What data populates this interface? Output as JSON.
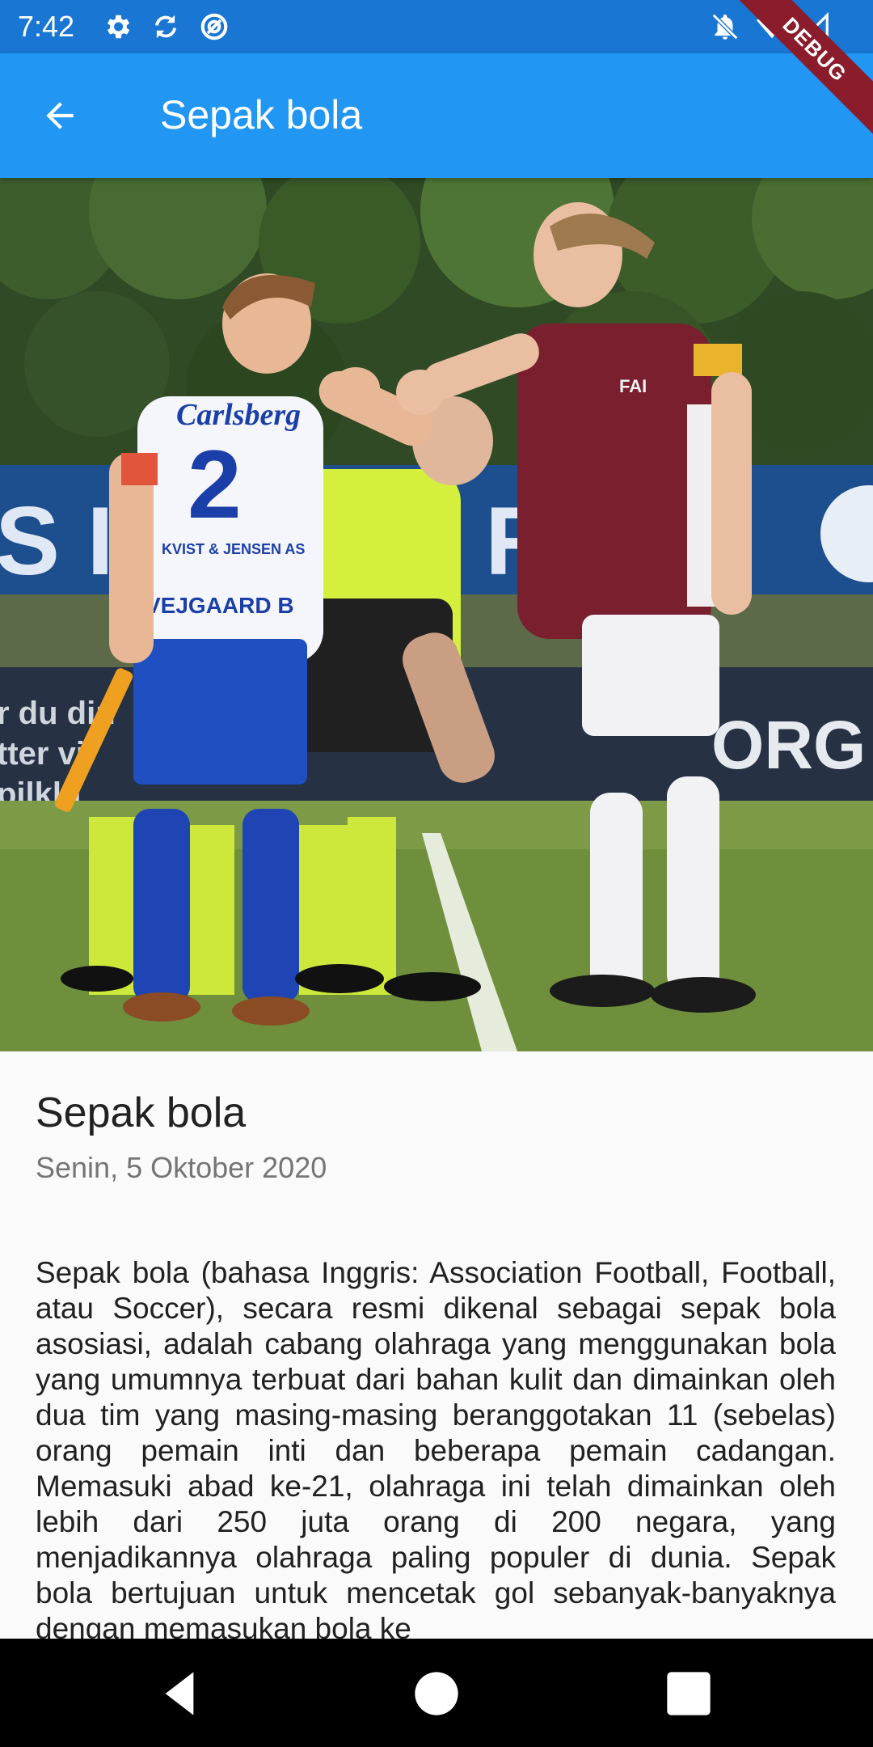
{
  "status_bar": {
    "time": "7:42",
    "left_icons": [
      "settings-icon",
      "sync-icon",
      "vpn-icon"
    ],
    "right_icons": [
      "notifications-off-icon",
      "wifi-icon",
      "signal-icon"
    ],
    "background_color": "#1976d2"
  },
  "app_bar": {
    "title": "Sepak bola",
    "back_icon": "arrow-back-icon",
    "background_color": "#2196f3"
  },
  "debug_banner": "DEBUG",
  "hero_image": {
    "jersey_sponsor": "Carlsberg",
    "jersey_number": "2",
    "jersey_name": "VEJGAARD B",
    "jersey_badge_text": "KVIST & JENSEN AS",
    "opponent_crest": "FAI",
    "banner_left_text": "S I",
    "banner_right_text": "R",
    "board_left_lines": [
      "r du din",
      "tter vi",
      "pilklu"
    ],
    "board_right_text": "ORG"
  },
  "article": {
    "title": "Sepak bola",
    "date": "Senin, 5 Oktober 2020",
    "body": "Sepak bola (bahasa Inggris: Association Football, Football, atau Soccer), secara resmi dikenal sebagai sepak bola asosiasi, adalah cabang olahraga yang menggunakan bola yang umumnya terbuat dari bahan kulit dan dimainkan oleh dua tim yang masing-masing beranggotakan 11 (sebelas) orang pemain inti dan beberapa pemain cadangan. Memasuki abad ke-21, olahraga ini telah dimainkan oleh lebih dari 250 juta orang di 200 negara, yang menjadikannya olahraga paling populer di dunia. Sepak bola bertujuan untuk mencetak gol sebanyak-banyaknya dengan memasukan bola ke"
  },
  "nav_bar": {
    "buttons": [
      "back-nav-icon",
      "home-nav-icon",
      "recents-nav-icon"
    ]
  }
}
